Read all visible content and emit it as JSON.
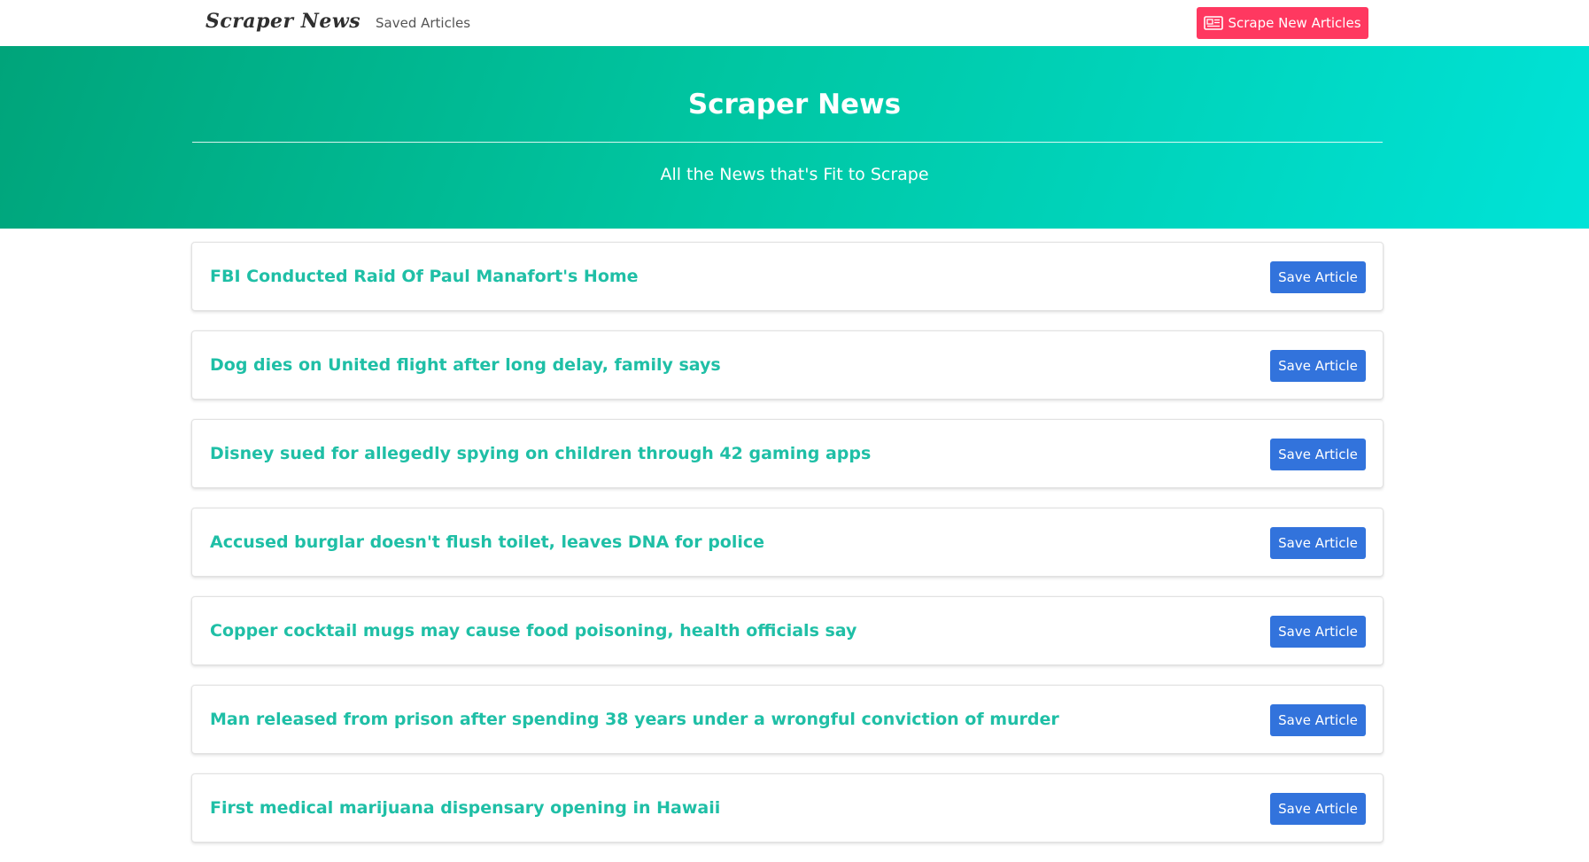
{
  "navbar": {
    "brand": "Scraper News",
    "saved_link": "Saved Articles",
    "scrape_button": "Scrape New Articles",
    "scrape_button_icon": "newspaper-icon",
    "scrape_button_color": "#ff3860"
  },
  "hero": {
    "title": "Scraper News",
    "subtitle": "All the News that's Fit to Scrape",
    "gradient_colors": [
      "#00a47a",
      "#00c6a2",
      "#00e3d8"
    ]
  },
  "articles": [
    {
      "title": "FBI Conducted Raid Of Paul Manafort's Home",
      "button": "Save Article"
    },
    {
      "title": "Dog dies on United flight after long delay, family says",
      "button": "Save Article"
    },
    {
      "title": "Disney sued for allegedly spying on children through 42 gaming apps",
      "button": "Save Article"
    },
    {
      "title": "Accused burglar doesn't flush toilet, leaves DNA for police",
      "button": "Save Article"
    },
    {
      "title": "Copper cocktail mugs may cause food poisoning, health officials say",
      "button": "Save Article"
    },
    {
      "title": "Man released from prison after spending 38 years under a wrongful conviction of murder",
      "button": "Save Article"
    },
    {
      "title": "First medical marijuana dispensary opening in Hawaii",
      "button": "Save Article"
    }
  ],
  "colors": {
    "article_title": "#1fbfa6",
    "save_button": "#3273dc"
  }
}
